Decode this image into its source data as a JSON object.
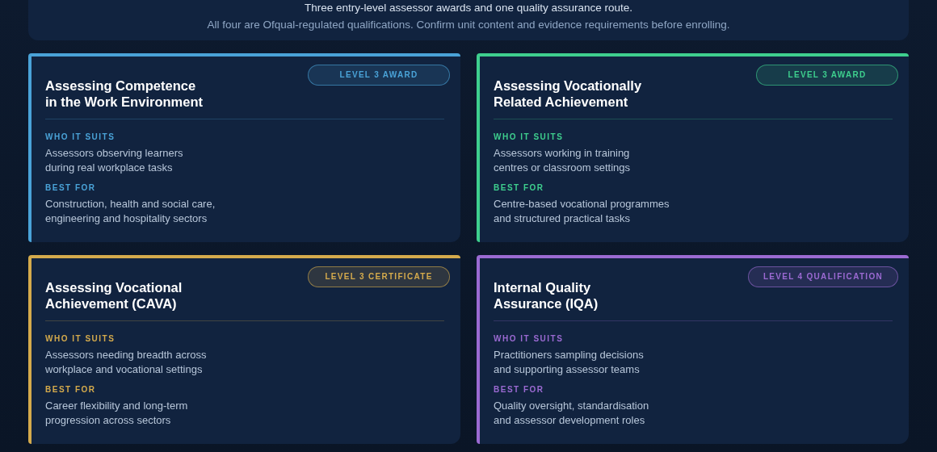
{
  "intro": {
    "lines": [
      "Three entry-level assessor awards and one quality assurance route.",
      "All four are Ofqual-regulated qualifications. Confirm unit content and evidence requirements before enrolling."
    ]
  },
  "cards": [
    {
      "color": "#4aa3d8",
      "badge": "LEVEL 3 AWARD",
      "title": [
        "Assessing Competence",
        "in the Work Environment"
      ],
      "sections": [
        {
          "label": "WHO IT SUITS",
          "text": [
            "Assessors observing learners",
            "during real workplace tasks"
          ]
        },
        {
          "label": "BEST FOR",
          "text": [
            "Construction, health and social care,",
            "engineering and hospitality sectors"
          ]
        }
      ]
    },
    {
      "color": "#3ecf8e",
      "badge": "LEVEL 3 AWARD",
      "title": [
        "Assessing Vocationally",
        "Related Achievement"
      ],
      "sections": [
        {
          "label": "WHO IT SUITS",
          "text": [
            "Assessors working in training",
            "centres or classroom settings"
          ]
        },
        {
          "label": "BEST FOR",
          "text": [
            "Centre-based vocational programmes",
            "and structured practical tasks"
          ]
        }
      ]
    },
    {
      "color": "#d4aa4c",
      "badge": "LEVEL 3 CERTIFICATE",
      "title": [
        "Assessing Vocational",
        "Achievement (CAVA)"
      ],
      "sections": [
        {
          "label": "WHO IT SUITS",
          "text": [
            "Assessors needing breadth across",
            "workplace and vocational settings"
          ]
        },
        {
          "label": "BEST FOR",
          "text": [
            "Career flexibility and long-term",
            "progression across sectors"
          ]
        }
      ]
    },
    {
      "color": "#9b6ad2",
      "badge": "LEVEL 4 QUALIFICATION",
      "title": [
        "Internal Quality",
        "Assurance (IQA)"
      ],
      "sections": [
        {
          "label": "WHO IT SUITS",
          "text": [
            "Practitioners sampling decisions",
            "and supporting assessor teams"
          ]
        },
        {
          "label": "BEST FOR",
          "text": [
            "Quality oversight, standardisation",
            "and assessor development roles"
          ]
        }
      ]
    }
  ]
}
